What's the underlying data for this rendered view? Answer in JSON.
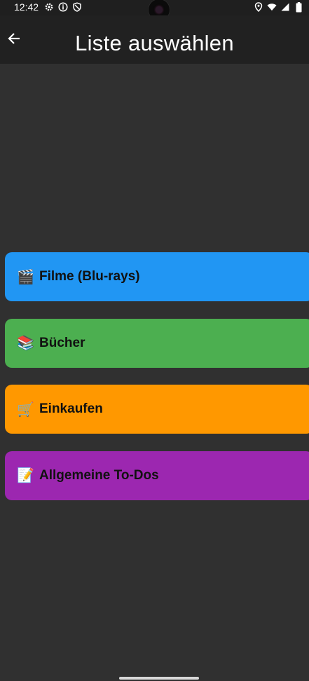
{
  "status_bar": {
    "time": "12:42",
    "left_icons": [
      "gear-icon",
      "info-icon",
      "shield-icon"
    ],
    "right_icons": [
      "location-icon",
      "wifi-icon",
      "signal-icon",
      "battery-icon"
    ]
  },
  "app_bar": {
    "back_icon": "arrow-left-icon",
    "title": "Liste auswählen"
  },
  "lists": [
    {
      "emoji": "🎬",
      "label": "Filme (Blu-rays)",
      "color": "#2196F3"
    },
    {
      "emoji": "📚",
      "label": "Bücher",
      "color": "#4CAF50"
    },
    {
      "emoji": "🛒",
      "label": "Einkaufen",
      "color": "#FF9800"
    },
    {
      "emoji": "📝",
      "label": "Allgemeine To-Dos",
      "color": "#9C27B0"
    }
  ]
}
